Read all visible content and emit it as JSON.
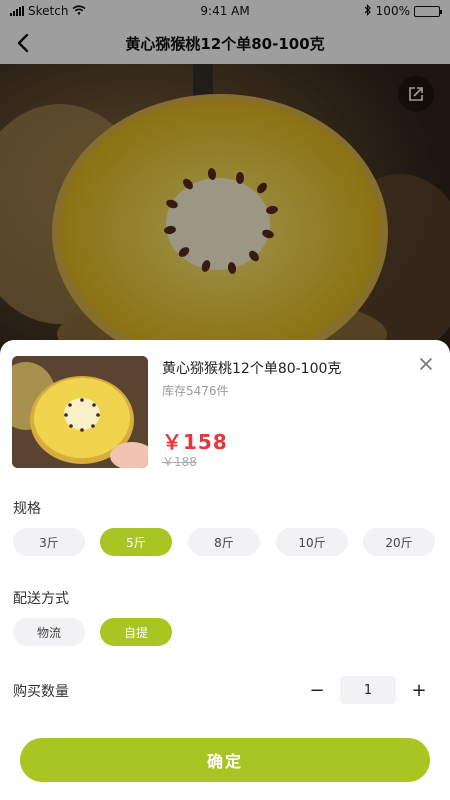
{
  "status_bar": {
    "carrier": "Sketch",
    "time": "9:41 AM",
    "battery": "100%",
    "signal_icon": "signal-bars-icon",
    "wifi_icon": "wifi-icon",
    "bluetooth_icon": "bluetooth-icon",
    "battery_icon": "battery-icon",
    "battery_level": 1.0
  },
  "nav": {
    "title": "黄心猕猴桃12个单80-100克",
    "back_icon": "chevron-left-icon"
  },
  "hero": {
    "share_icon": "share-icon"
  },
  "sheet": {
    "product_name": "黄心猕猴桃12个单80-100克",
    "stock": "库存5476件",
    "price": "￥158",
    "original_price": "￥188",
    "close_icon": "close-icon",
    "spec": {
      "title": "规格",
      "options": [
        "3斤",
        "5斤",
        "8斤",
        "10斤",
        "20斤"
      ],
      "selected": "5斤"
    },
    "delivery": {
      "title": "配送方式",
      "options": [
        "物流",
        "自提"
      ],
      "selected": "自提"
    },
    "quantity": {
      "title": "购买数量",
      "minus": "−",
      "value": "1",
      "plus": "+"
    },
    "confirm_label": "确定"
  },
  "colors": {
    "accent": "#a8c521",
    "price": "#e8343a",
    "chip_bg": "#f2f2f4"
  }
}
